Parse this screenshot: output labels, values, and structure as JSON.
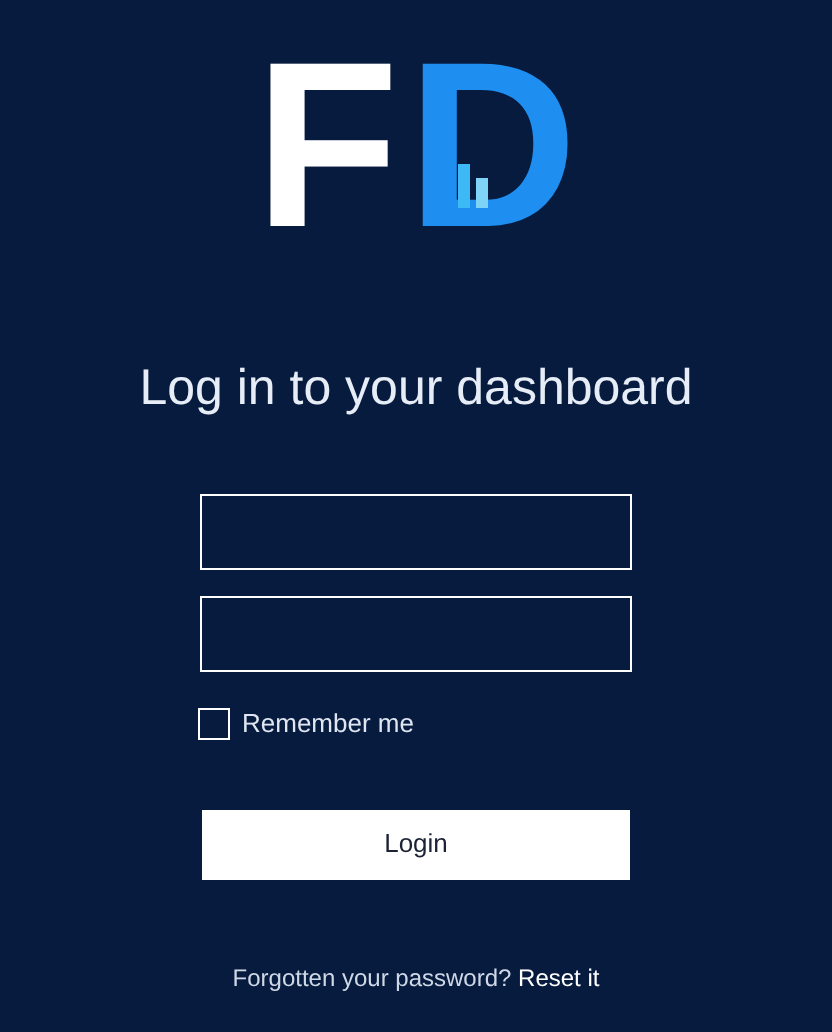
{
  "logo": {
    "letters": [
      "F",
      "D"
    ]
  },
  "heading": "Log in to your dashboard",
  "remember": {
    "label": "Remember me",
    "checked": false
  },
  "login_button": "Login",
  "footer": {
    "text": "Forgotten your password?",
    "link": "Reset it"
  }
}
